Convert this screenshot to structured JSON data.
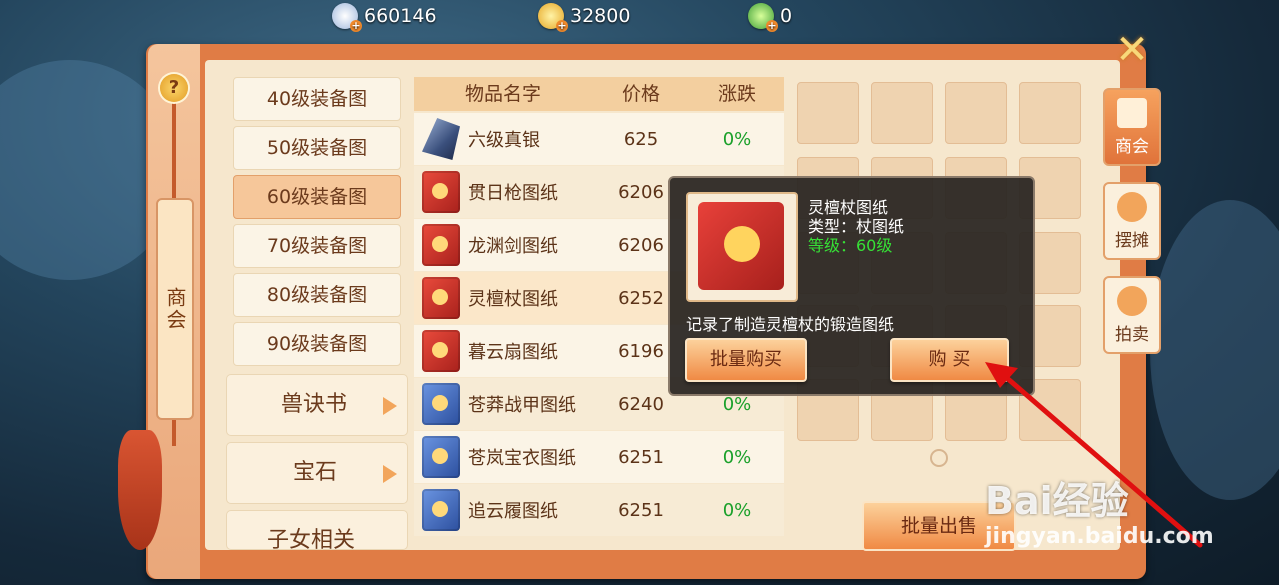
{
  "currency": [
    {
      "icon": "silver-coin-icon",
      "value": "660146"
    },
    {
      "icon": "gold-coin-icon",
      "value": "32800"
    },
    {
      "icon": "jade-coin-icon",
      "value": "0"
    }
  ],
  "sidebar": {
    "help": "?",
    "vertical_tab": "商会"
  },
  "categories": [
    "40级装备图",
    "50级装备图",
    "60级装备图",
    "70级装备图",
    "80级装备图",
    "90级装备图"
  ],
  "category_groups": [
    "兽诀书",
    "宝石",
    "子女相关"
  ],
  "table": {
    "headers": [
      "物品名字",
      "价格",
      "涨跌"
    ],
    "rows": [
      {
        "name": "六级真银",
        "price": "625",
        "change": "0%",
        "icon": "ore-icon"
      },
      {
        "name": "贯日枪图纸",
        "price": "6206",
        "change": "",
        "icon": "red-book-icon"
      },
      {
        "name": "龙渊剑图纸",
        "price": "6206",
        "change": "",
        "icon": "red-book-icon"
      },
      {
        "name": "灵檀杖图纸",
        "price": "6252",
        "change": "",
        "icon": "red-book-icon"
      },
      {
        "name": "暮云扇图纸",
        "price": "6196",
        "change": "",
        "icon": "red-book-icon"
      },
      {
        "name": "苍莽战甲图纸",
        "price": "6240",
        "change": "0%",
        "icon": "blue-book-icon"
      },
      {
        "name": "苍岚宝衣图纸",
        "price": "6251",
        "change": "0%",
        "icon": "blue-book-icon"
      },
      {
        "name": "追云履图纸",
        "price": "6251",
        "change": "0%",
        "icon": "blue-book-icon"
      }
    ]
  },
  "popup": {
    "title": "灵檀杖图纸",
    "type": "类型：杖图纸",
    "level": "等级：60级",
    "description": "记录了制造灵檀杖的锻造图纸",
    "bulk_buy": "批量购买",
    "buy": "购 买"
  },
  "bulk_sell": "批量出售",
  "right_tabs": [
    "商会",
    "摆摊",
    "拍卖"
  ],
  "watermark": {
    "main": "Bai经验",
    "sub": "jingyan.baidu.com"
  },
  "colors": {
    "accent": "#e07c45",
    "positive": "#1aa02a",
    "level_green": "#36e036"
  }
}
